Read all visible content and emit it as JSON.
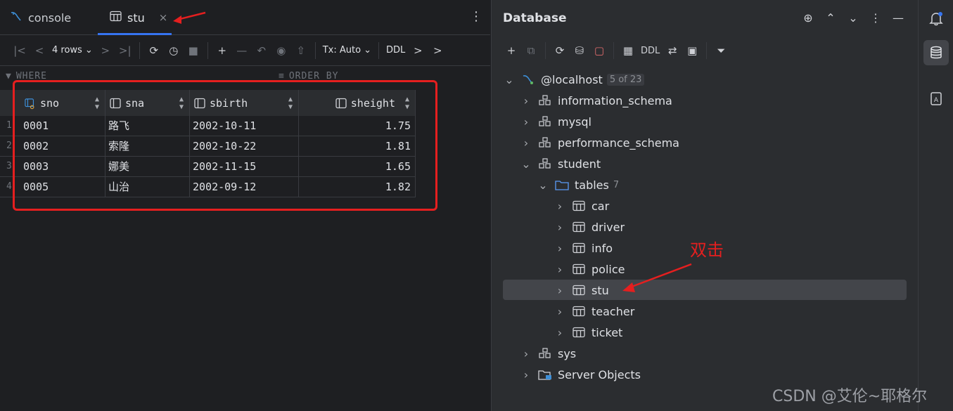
{
  "editor": {
    "tabs": [
      {
        "label": "console",
        "icon": "mysql-icon"
      },
      {
        "label": "stu",
        "icon": "table-icon",
        "close": "×"
      }
    ]
  },
  "toolbar": {
    "rows_label": "4 rows",
    "tx_label": "Tx: Auto",
    "ddl_label": "DDL"
  },
  "filters": {
    "where": "WHERE",
    "order_by": "ORDER BY"
  },
  "grid": {
    "columns": [
      {
        "name": "sno",
        "icon": "key-column-icon"
      },
      {
        "name": "sna",
        "icon": "column-icon"
      },
      {
        "name": "sbirth",
        "icon": "column-icon"
      },
      {
        "name": "sheight",
        "icon": "column-icon"
      }
    ],
    "rows": [
      {
        "n": "1",
        "sno": "0001",
        "sna": "路飞",
        "sbirth": "2002-10-11",
        "sheight": "1.75"
      },
      {
        "n": "2",
        "sno": "0002",
        "sna": "索隆",
        "sbirth": "2002-10-22",
        "sheight": "1.81"
      },
      {
        "n": "3",
        "sno": "0003",
        "sna": "娜美",
        "sbirth": "2002-11-15",
        "sheight": "1.65"
      },
      {
        "n": "4",
        "sno": "0005",
        "sna": "山治",
        "sbirth": "2002-09-12",
        "sheight": "1.82"
      }
    ]
  },
  "database": {
    "title": "Database",
    "ddl_label": "DDL",
    "root": {
      "label": "@localhost",
      "badge": "5 of 23"
    },
    "schemas": [
      "information_schema",
      "mysql",
      "performance_schema",
      "student",
      "sys"
    ],
    "tables_folder": {
      "label": "tables",
      "count": "7"
    },
    "tables": [
      "car",
      "driver",
      "info",
      "police",
      "stu",
      "teacher",
      "ticket"
    ],
    "server_objects": "Server Objects"
  },
  "annotation": "双击",
  "watermark": "CSDN @艾伦~耶格尔",
  "colors": {
    "accent": "#3574f0",
    "annotation_red": "#e51f1f",
    "selection": "#43454a"
  }
}
